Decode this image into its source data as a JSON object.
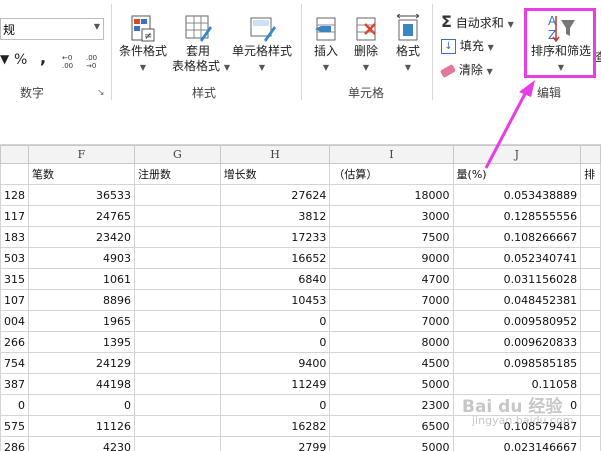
{
  "ribbon": {
    "number_group": {
      "dropdown_value": "规",
      "percent": "%",
      "comma": ",",
      "inc_decimal": ".00→.0",
      "dec_decimal": ".00→.0",
      "label": "数字"
    },
    "styles_group": {
      "conditional_format": "条件格式",
      "table_format_line1": "套用",
      "table_format_line2": "表格格式",
      "cell_styles": "单元格样式",
      "label": "样式"
    },
    "cells_group": {
      "insert": "插入",
      "delete": "删除",
      "format": "格式",
      "label": "单元格"
    },
    "editing_group": {
      "autosum": "自动求和",
      "fill": "填充",
      "clear": "清除",
      "sort_filter": "排序和筛选",
      "find_partial": "查",
      "label": "编辑"
    }
  },
  "sheet": {
    "columns": [
      "",
      "F",
      "G",
      "H",
      "I",
      "J",
      ""
    ],
    "header_row": [
      "",
      "笔数",
      "注册数",
      "增长数",
      "（估算）",
      "量(%)",
      "排"
    ],
    "rows": [
      [
        "128",
        "36533",
        "",
        "27624",
        "18000",
        "0.053438889"
      ],
      [
        "117",
        "24765",
        "",
        "3812",
        "3000",
        "0.128555556"
      ],
      [
        "183",
        "23420",
        "",
        "17233",
        "7500",
        "0.108266667"
      ],
      [
        "503",
        "4903",
        "",
        "16652",
        "9000",
        "0.052340741"
      ],
      [
        "315",
        "1061",
        "",
        "6840",
        "4700",
        "0.031156028"
      ],
      [
        "107",
        "8896",
        "",
        "10453",
        "7000",
        "0.048452381"
      ],
      [
        "004",
        "1965",
        "",
        "0",
        "7000",
        "0.009580952"
      ],
      [
        "266",
        "1395",
        "",
        "0",
        "8000",
        "0.009620833"
      ],
      [
        "754",
        "24129",
        "",
        "9400",
        "4500",
        "0.098585185"
      ],
      [
        "387",
        "44198",
        "",
        "11249",
        "5000",
        "0.11058"
      ],
      [
        "0",
        "0",
        "",
        "0",
        "2300",
        "0"
      ],
      [
        "575",
        "11126",
        "",
        "16282",
        "6500",
        "0.108579487"
      ],
      [
        "286",
        "4230",
        "",
        "2799",
        "5000",
        "0.023146667"
      ]
    ]
  },
  "watermark": {
    "main": "Bai du 经验",
    "sub": "jingyan.baidu.com"
  },
  "colors": {
    "highlight": "#e83ce6",
    "grid": "#d4d4d4"
  }
}
